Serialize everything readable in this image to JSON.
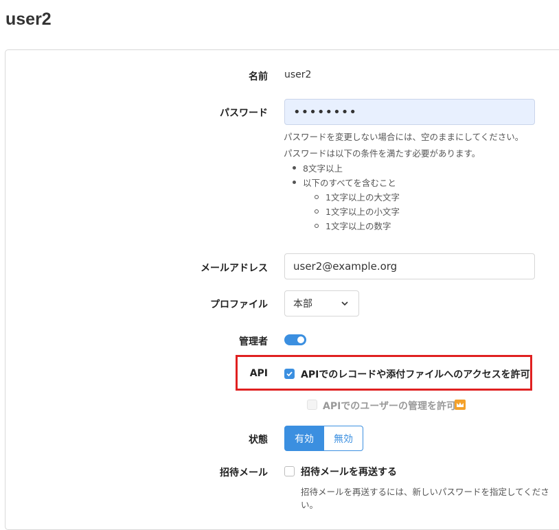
{
  "page": {
    "title": "user2"
  },
  "form": {
    "name": {
      "label": "名前",
      "value": "user2"
    },
    "password": {
      "label": "パスワード",
      "value": "••••••••",
      "help_keep": "パスワードを変更しない場合には、空のままにしてください。",
      "help_rules_intro": "パスワードは以下の条件を満たす必要があります。",
      "rules": [
        {
          "text": "8文字以上"
        },
        {
          "text": "以下のすべてを含むこと"
        }
      ],
      "sub_rules": [
        {
          "text": "1文字以上の大文字"
        },
        {
          "text": "1文字以上の小文字"
        },
        {
          "text": "1文字以上の数字"
        }
      ]
    },
    "email": {
      "label": "メールアドレス",
      "value": "user2@example.org"
    },
    "profile": {
      "label": "プロファイル",
      "selected": "本部"
    },
    "admin": {
      "label": "管理者",
      "enabled": true
    },
    "api": {
      "label": "API",
      "allow_records": {
        "label": "APIでのレコードや添付ファイルへのアクセスを許可",
        "checked": true
      },
      "allow_user_admin": {
        "label": "APIでのユーザーの管理を許可",
        "checked": false,
        "disabled": true,
        "badge_icon": "crown-icon"
      }
    },
    "status": {
      "label": "状態",
      "options": [
        "有効",
        "無効"
      ],
      "selected": "有効"
    },
    "invite": {
      "label": "招待メール",
      "resend": {
        "label": "招待メールを再送する",
        "checked": false
      },
      "help": "招待メールを再送するには、新しいパスワードを指定してください。"
    }
  },
  "colors": {
    "accent": "#3b8fe0",
    "highlight": "#e02020",
    "crown": "#f4a12a"
  }
}
